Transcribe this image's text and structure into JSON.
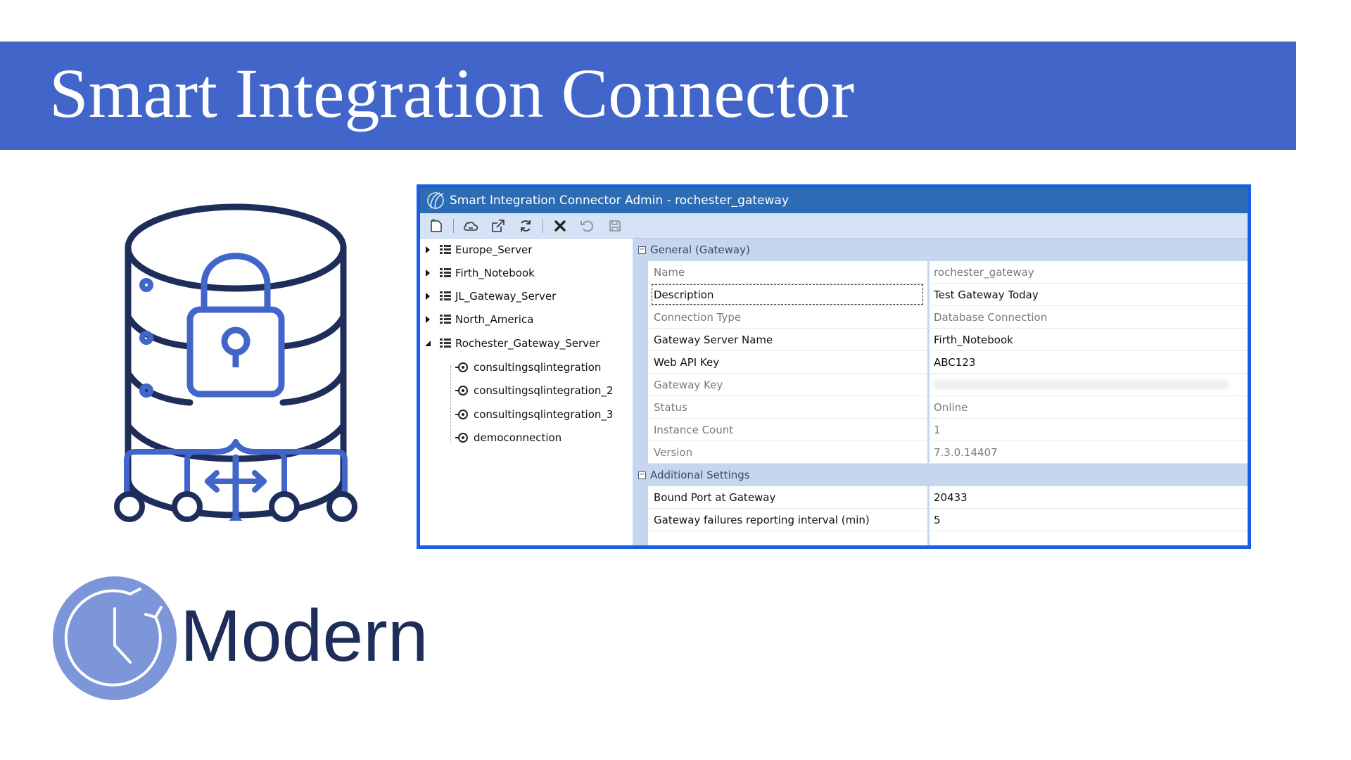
{
  "slide": {
    "title": "Smart Integration Connector",
    "logo_text": "Modern",
    "banner_color": "#4165c8"
  },
  "window": {
    "title": "Smart Integration Connector Admin - rochester_gateway",
    "toolbar": [
      {
        "icon": "new-icon"
      },
      {
        "icon": "cloud-icon"
      },
      {
        "icon": "export-icon"
      },
      {
        "icon": "refresh-icon"
      },
      {
        "icon": "delete-icon"
      },
      {
        "icon": "undo-icon"
      },
      {
        "icon": "save-icon"
      }
    ]
  },
  "tree": {
    "servers": [
      {
        "label": "Europe_Server",
        "expanded": false
      },
      {
        "label": "Firth_Notebook",
        "expanded": false
      },
      {
        "label": "JL_Gateway_Server",
        "expanded": false
      },
      {
        "label": "North_America",
        "expanded": false
      },
      {
        "label": "Rochester_Gateway_Server",
        "expanded": true
      }
    ],
    "connections": [
      {
        "label": "consultingsqlintegration"
      },
      {
        "label": "consultingsqlintegration_2"
      },
      {
        "label": "consultingsqlintegration_3"
      },
      {
        "label": "democonnection"
      }
    ]
  },
  "properties": {
    "general": {
      "label": "General (Gateway)",
      "rows": [
        {
          "name": "Name",
          "value": "rochester_gateway"
        },
        {
          "name": "Description",
          "value": "Test Gateway Today"
        },
        {
          "name": "Connection Type",
          "value": "Database Connection"
        },
        {
          "name": "Gateway Server Name",
          "value": "Firth_Notebook"
        },
        {
          "name": "Web API Key",
          "value": "ABC123"
        },
        {
          "name": "Gateway Key",
          "value": ""
        },
        {
          "name": "Status",
          "value": "Online"
        },
        {
          "name": "Instance Count",
          "value": "1"
        },
        {
          "name": "Version",
          "value": "7.3.0.14407"
        }
      ]
    },
    "additional": {
      "label": "Additional Settings",
      "rows": [
        {
          "name": "Bound Port at Gateway",
          "value": "20433"
        },
        {
          "name": "Gateway failures reporting interval (min)",
          "value": "5"
        }
      ]
    }
  }
}
